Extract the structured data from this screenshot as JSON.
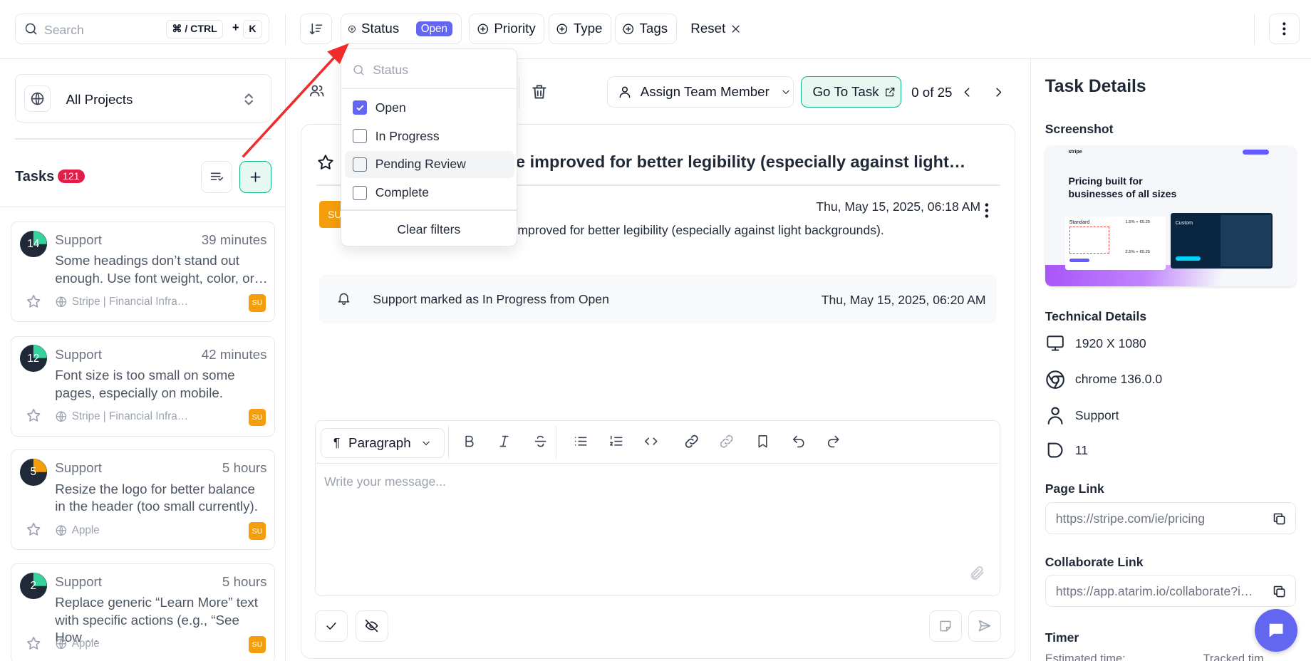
{
  "topbar": {
    "search_placeholder": "Search",
    "shortcut_cmd": "⌘ / CTRL",
    "shortcut_plus": "+",
    "shortcut_key": "K",
    "filters": {
      "status": "Status",
      "status_badge": "Open",
      "priority": "Priority",
      "type": "Type",
      "tags": "Tags",
      "reset": "Reset"
    }
  },
  "status_dropdown": {
    "search_placeholder": "Status",
    "options": [
      {
        "label": "Open",
        "checked": true
      },
      {
        "label": "In Progress",
        "checked": false
      },
      {
        "label": "Pending Review",
        "checked": false
      },
      {
        "label": "Complete",
        "checked": false
      }
    ],
    "clear": "Clear filters"
  },
  "sidebar": {
    "project_select": "All Projects",
    "tasks_title": "Tasks",
    "tasks_count": "121",
    "tasks": [
      {
        "num": "14",
        "cat": "Support",
        "time": "39 minutes",
        "text": "Some headings don’t stand out enough. Use font weight, color, or…",
        "project": "Stripe | Financial Infra…",
        "badge": "SU",
        "progress": 0.25
      },
      {
        "num": "12",
        "cat": "Support",
        "time": "42 minutes",
        "text": "Font size is too small on some pages, especially on mobile.",
        "project": "Stripe | Financial Infra…",
        "badge": "SU",
        "progress": 0.25
      },
      {
        "num": "5",
        "cat": "Support",
        "time": "5 hours",
        "text": "Resize the logo for better balance in the header (too small currently).",
        "project": "Apple",
        "badge": "SU",
        "progress": 0.25
      },
      {
        "num": "2",
        "cat": "Support",
        "time": "5 hours",
        "text": "Replace generic “Learn More” text with specific actions (e.g., “See How …",
        "project": "Apple",
        "badge": "SU",
        "progress": 0.25
      }
    ]
  },
  "main": {
    "assign": "Assign Team Member",
    "go_to_task": "Go To Task",
    "pager": "0 of 25",
    "task_title": "e improved for better legibility (especially against light…",
    "badge_partial": "SU",
    "comment_date": "Thu, May 15, 2025, 06:18 AM",
    "comment_text": "mproved for better legibility (especially against light backgrounds).",
    "activity_text": "Support marked as In Progress from Open",
    "activity_date": "Thu, May 15, 2025, 06:20 AM",
    "editor_block": "Paragraph",
    "editor_placeholder": "Write your message..."
  },
  "details": {
    "title": "Task Details",
    "screenshot_label": "Screenshot",
    "thumb_heading": "Pricing built for businesses of all sizes",
    "thumb_logo": "stripe",
    "thumb_standard": "Standard",
    "thumb_custom": "Custom",
    "thumb_rate1": "1.5% + €0.25",
    "thumb_rate2": "2.5% + €0.25",
    "technical_label": "Technical Details",
    "resolution": "1920 X 1080",
    "browser": "chrome 136.0.0",
    "user": "Support",
    "tag_count": "11",
    "page_link_label": "Page Link",
    "page_link": "https://stripe.com/ie/pricing",
    "collab_label": "Collaborate Link",
    "collab_link": "https://app.atarim.io/collaborate?i…",
    "timer_label": "Timer",
    "timer_partial": "Estimated time:",
    "timer_partial2": "Tracked tim"
  },
  "colors": {
    "accent": "#6366f1",
    "badge_pink": "#e11d48",
    "orange": "#f59e0b",
    "green_btn": "#d1fae5",
    "arrow_red": "#ef2b2b"
  }
}
